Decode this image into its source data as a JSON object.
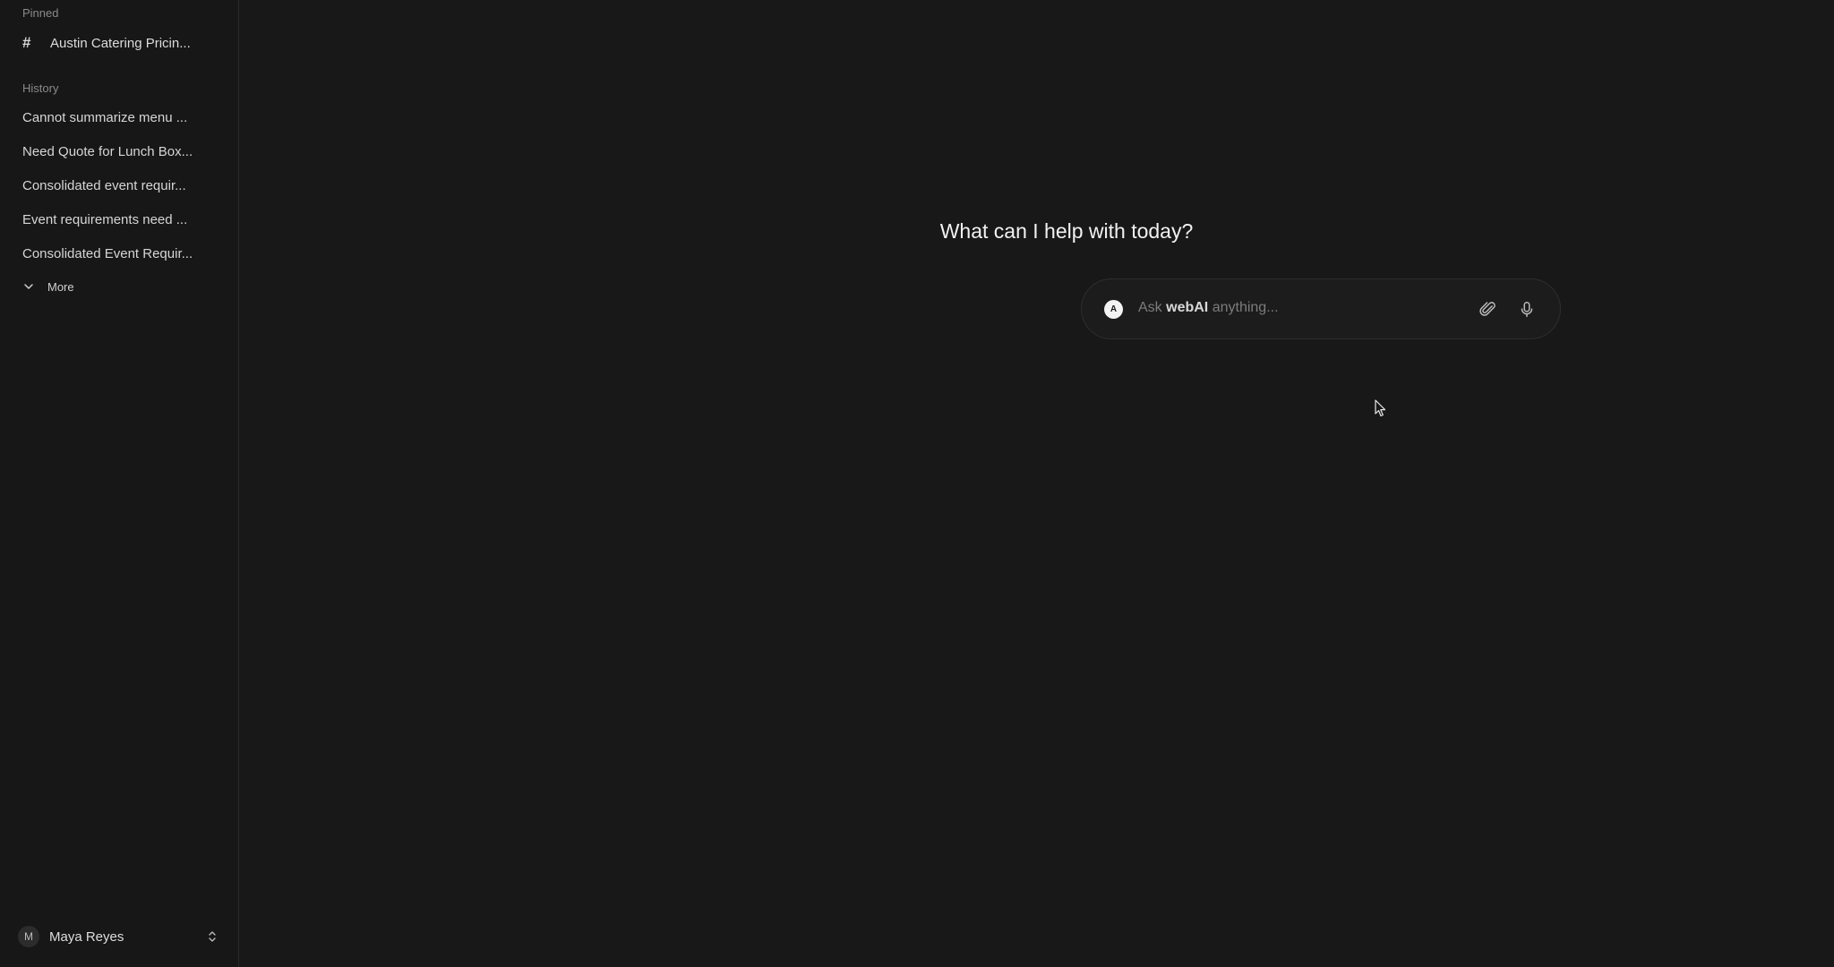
{
  "sidebar": {
    "pinned_label": "Pinned",
    "pinned": [
      {
        "label": "Austin Catering Pricin..."
      }
    ],
    "history_label": "History",
    "history": [
      {
        "label": "Cannot summarize menu ..."
      },
      {
        "label": "Need Quote for Lunch Box..."
      },
      {
        "label": "Consolidated event requir..."
      },
      {
        "label": "Event requirements need ..."
      },
      {
        "label": "Consolidated Event Requir..."
      }
    ],
    "more_label": "More",
    "user": {
      "initial": "M",
      "name": "Maya Reyes"
    }
  },
  "main": {
    "headline": "What can I help with today?",
    "composer": {
      "model_initial": "A",
      "placeholder_prefix": "Ask",
      "placeholder_brand": "webAI",
      "placeholder_suffix": "anything..."
    }
  },
  "icons": {
    "pinned_item": "hash-icon",
    "more": "chevron-down-icon",
    "user_switch": "chevron-up-down-icon",
    "attach": "paperclip-icon",
    "mic": "microphone-icon",
    "cursor": "mouse-pointer-icon"
  },
  "colors": {
    "background": "#181818",
    "sidebar": "#171717",
    "text": "#e6e6e6",
    "muted": "#8a8a8a"
  }
}
